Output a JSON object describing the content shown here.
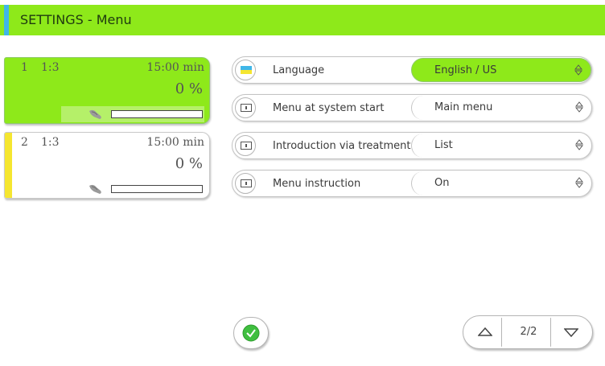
{
  "header": {
    "title": "SETTINGS - Menu"
  },
  "colors": {
    "accent": "#8ee91a",
    "title_accent": "#3fb6e8",
    "panel2_bar": "#f5e630"
  },
  "treatments": [
    {
      "number": "1",
      "ratio": "1:3",
      "time": "15:00 min",
      "percent": "0 %",
      "progress": 0
    },
    {
      "number": "2",
      "ratio": "1:3",
      "time": "15:00 min",
      "percent": "0 %",
      "progress": 0
    }
  ],
  "settings": [
    {
      "label": "Language",
      "value": "English / US",
      "icon": "flag-icon",
      "active": true
    },
    {
      "label": "Menu at system start",
      "value": "Main menu",
      "icon": "keyboard-icon",
      "active": false
    },
    {
      "label": "Introduction via treatment",
      "value": "List",
      "icon": "keyboard-icon",
      "active": false
    },
    {
      "label": "Menu instruction",
      "value": "On",
      "icon": "keyboard-icon",
      "active": false
    }
  ],
  "pager": {
    "page": "2/2"
  }
}
